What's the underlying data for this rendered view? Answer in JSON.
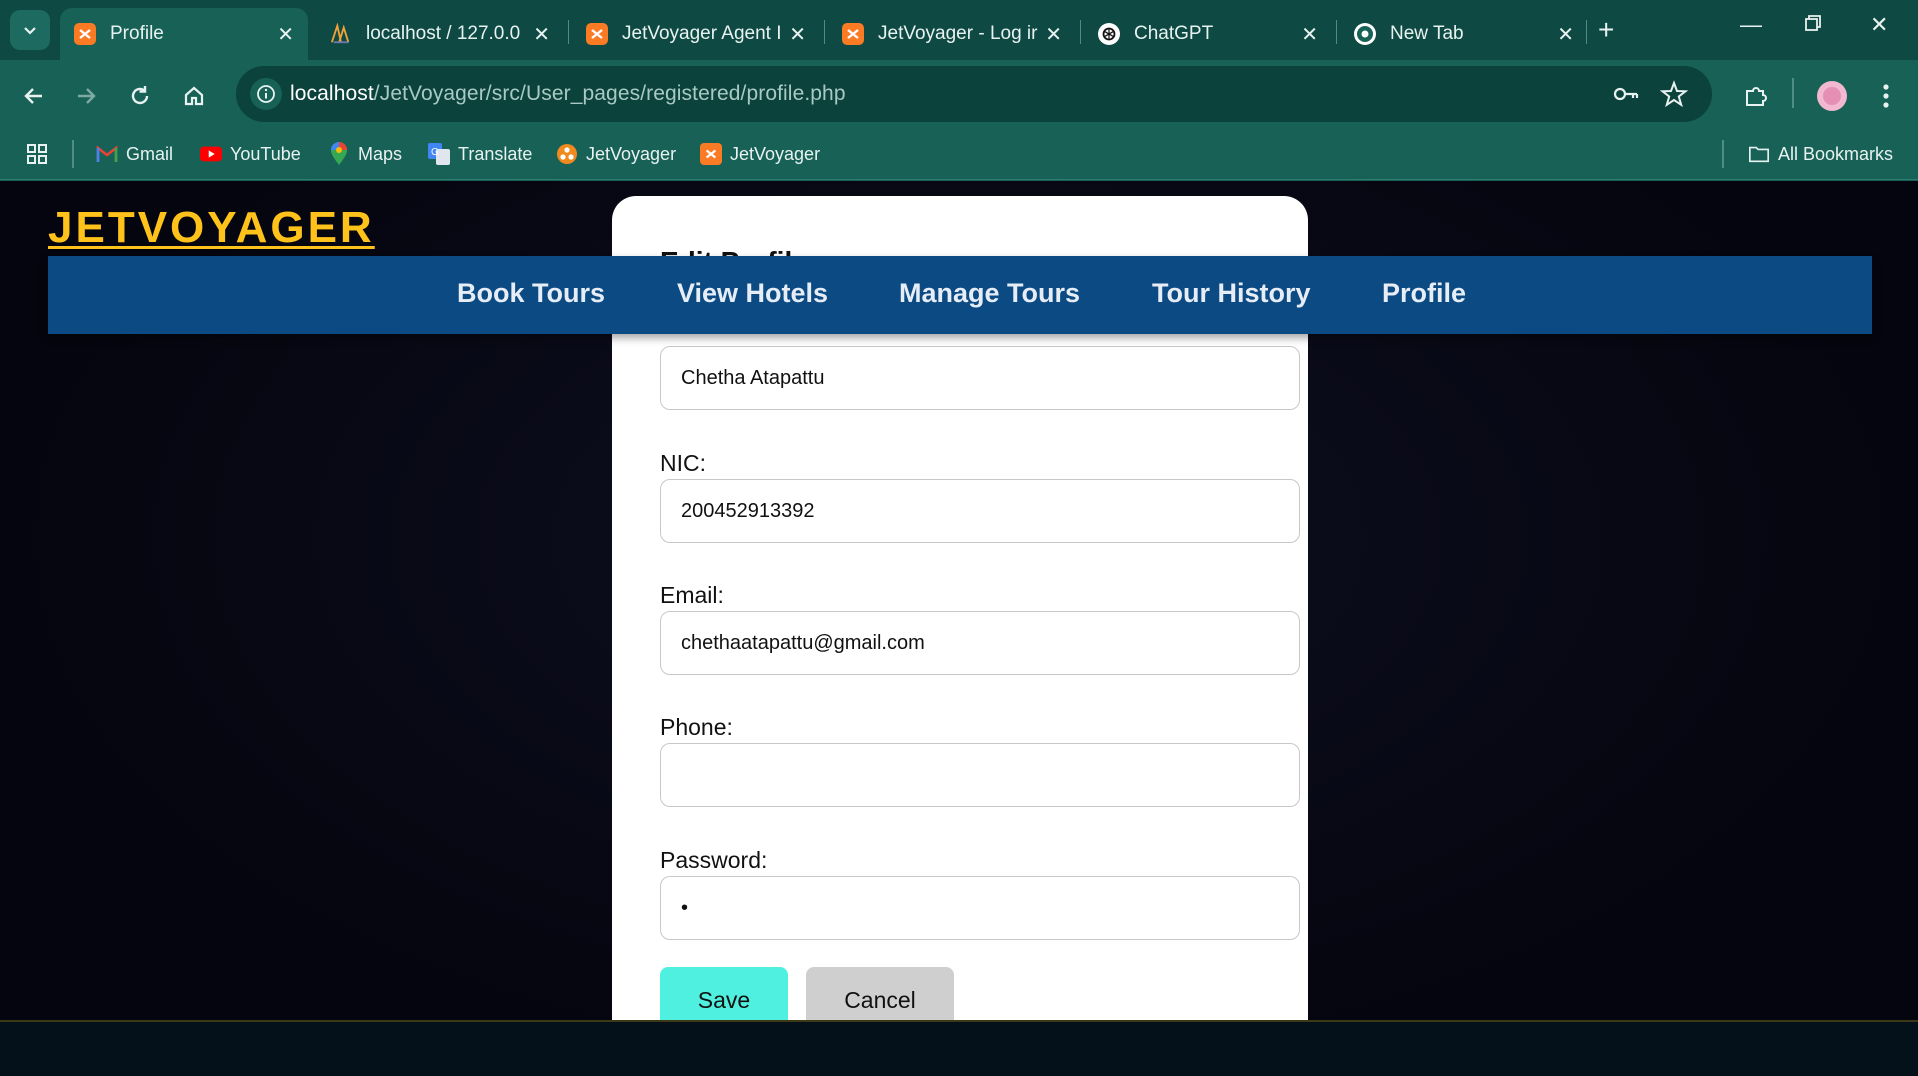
{
  "browser": {
    "tabs": [
      {
        "title": "Profile",
        "active": true,
        "icon": "xampp-icon"
      },
      {
        "title": "localhost / 127.0.0",
        "active": false,
        "icon": "phpmyadmin-icon"
      },
      {
        "title": "JetVoyager Agent I",
        "active": false,
        "icon": "xampp-icon"
      },
      {
        "title": "JetVoyager - Log ir",
        "active": false,
        "icon": "xampp-icon"
      },
      {
        "title": "ChatGPT",
        "active": false,
        "icon": "chatgpt-icon"
      },
      {
        "title": "New Tab",
        "active": false,
        "icon": "chrome-icon"
      }
    ],
    "url_host": "localhost",
    "url_path": "/JetVoyager/src/User_pages/registered/profile.php",
    "bookmarks": [
      {
        "label": "Gmail",
        "icon": "gmail-icon"
      },
      {
        "label": "YouTube",
        "icon": "youtube-icon"
      },
      {
        "label": "Maps",
        "icon": "maps-icon"
      },
      {
        "label": "Translate",
        "icon": "translate-icon"
      },
      {
        "label": "JetVoyager",
        "icon": "jetvoyager-icon"
      },
      {
        "label": "JetVoyager",
        "icon": "xampp-icon"
      }
    ],
    "all_bookmarks": "All Bookmarks",
    "colors": {
      "frame": "#0e4a43",
      "toolbar": "#176157",
      "omnibox": "#0b423c"
    }
  },
  "site": {
    "brand": "JETVOYAGER",
    "nav": [
      "Book Tours",
      "View Hotels",
      "Manage Tours",
      "Tour History",
      "Profile"
    ],
    "colors": {
      "brand": "#ffc21a",
      "nav_bg": "#0b4a82",
      "save": "#4ff0df",
      "cancel": "#cfcfcf"
    }
  },
  "modal": {
    "title": "Edit Profile",
    "name_value": "Chetha Atapattu",
    "nic_label": "NIC:",
    "nic_value": "200452913392",
    "email_label": "Email:",
    "email_value": "chethaatapattu@gmail.com",
    "phone_label": "Phone:",
    "phone_value": "",
    "password_label": "Password:",
    "password_value": "•",
    "save": "Save",
    "cancel": "Cancel"
  }
}
